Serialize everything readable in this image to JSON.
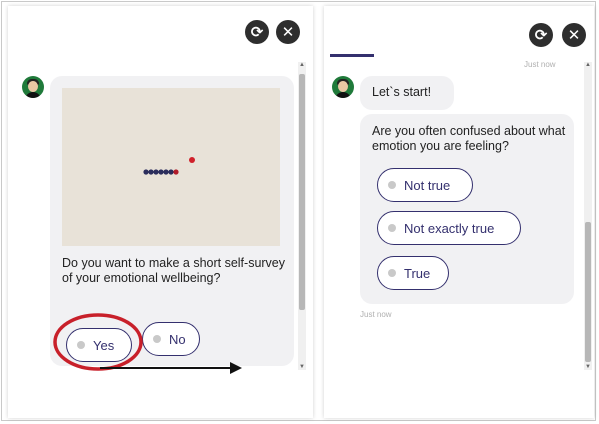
{
  "icons": {
    "refresh": "refresh-icon",
    "close": "close-icon",
    "avatar": "avatar-icon",
    "option_bullet": "circle-icon"
  },
  "glyphs": {
    "refresh": "⟳",
    "close": "✕",
    "scroll_up": "▲",
    "scroll_down": "▼"
  },
  "colors": {
    "accent": "#34306e",
    "highlight_circle": "#c8202a",
    "bubble_bg": "#f1f1f3",
    "image_bg": "#e8e2d8"
  },
  "left_panel": {
    "question": "Do you want to make a short self-survey of your emotional wellbeing?",
    "options": [
      "Yes",
      "No"
    ]
  },
  "right_panel": {
    "timestamp_top": "Just now",
    "greeting": "Let`s start!",
    "question": "Are you often confused about what emotion you are feeling?",
    "options": [
      "Not true",
      "Not exactly true",
      "True"
    ],
    "timestamp_bottom": "Just now"
  }
}
